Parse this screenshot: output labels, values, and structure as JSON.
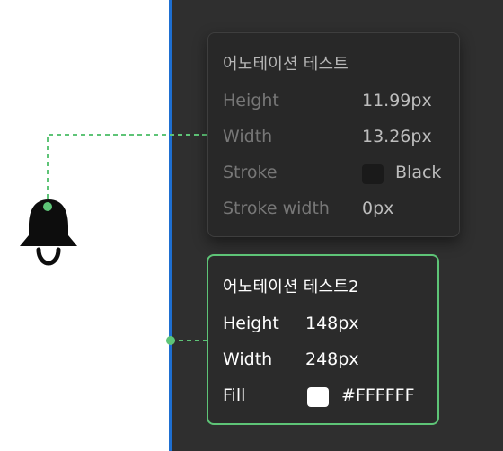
{
  "annotation_1": {
    "title": "어노테이션 테스트",
    "rows": [
      {
        "label": "Height",
        "value": "11.99px"
      },
      {
        "label": "Width",
        "value": "13.26px"
      },
      {
        "label": "Stroke",
        "value": "Black",
        "swatch_color": "#1A1A1A"
      },
      {
        "label": "Stroke width",
        "value": "0px"
      }
    ]
  },
  "annotation_2": {
    "title": "어노테이션 테스트2",
    "rows": [
      {
        "label": "Height",
        "value": "148px"
      },
      {
        "label": "Width",
        "value": "248px"
      },
      {
        "label": "Fill",
        "value": "#FFFFFF",
        "swatch_color": "#FFFFFF"
      }
    ]
  },
  "icons": {
    "bell": "bell-icon"
  },
  "colors": {
    "accent": "#5EC477",
    "frame_edge": "#1E6FD1",
    "panel_bg": "#2F2F2F"
  }
}
